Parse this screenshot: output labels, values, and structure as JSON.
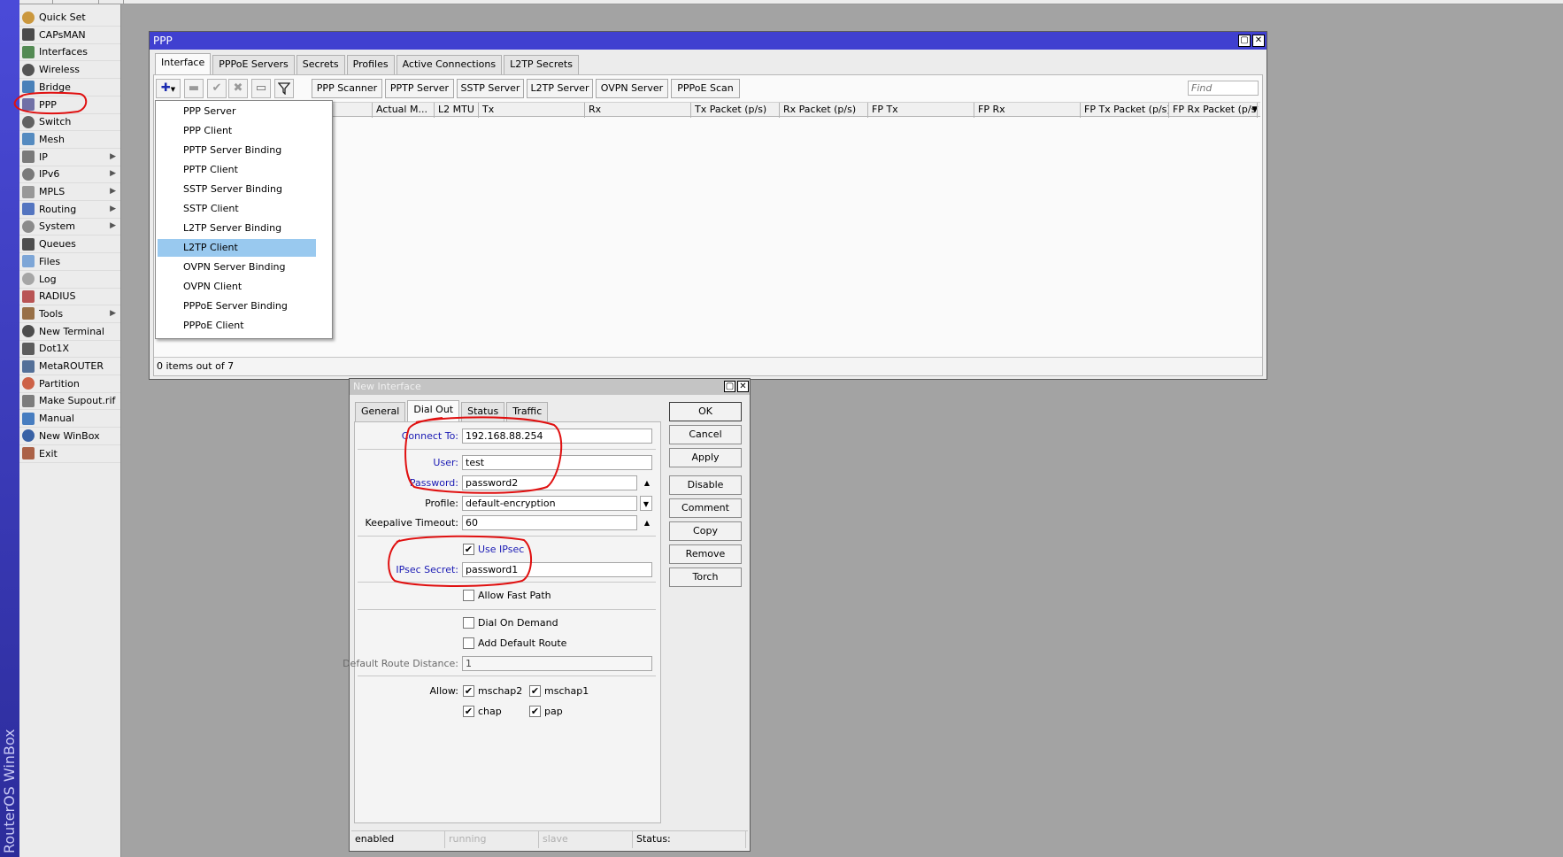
{
  "brand": "RouterOS WinBox",
  "sidebar": {
    "items": [
      {
        "label": "Quick Set",
        "icon": "quick-set-icon"
      },
      {
        "label": "CAPsMAN",
        "icon": "capsman-icon"
      },
      {
        "label": "Interfaces",
        "icon": "interfaces-icon"
      },
      {
        "label": "Wireless",
        "icon": "wireless-icon"
      },
      {
        "label": "Bridge",
        "icon": "bridge-icon"
      },
      {
        "label": "PPP",
        "icon": "ppp-icon"
      },
      {
        "label": "Switch",
        "icon": "switch-icon"
      },
      {
        "label": "Mesh",
        "icon": "mesh-icon"
      },
      {
        "label": "IP",
        "icon": "ip-icon",
        "submenu": true
      },
      {
        "label": "IPv6",
        "icon": "ipv6-icon",
        "submenu": true
      },
      {
        "label": "MPLS",
        "icon": "mpls-icon",
        "submenu": true
      },
      {
        "label": "Routing",
        "icon": "routing-icon",
        "submenu": true
      },
      {
        "label": "System",
        "icon": "system-icon",
        "submenu": true
      },
      {
        "label": "Queues",
        "icon": "queues-icon"
      },
      {
        "label": "Files",
        "icon": "files-icon"
      },
      {
        "label": "Log",
        "icon": "log-icon"
      },
      {
        "label": "RADIUS",
        "icon": "radius-icon"
      },
      {
        "label": "Tools",
        "icon": "tools-icon",
        "submenu": true
      },
      {
        "label": "New Terminal",
        "icon": "terminal-icon"
      },
      {
        "label": "Dot1X",
        "icon": "dot1x-icon"
      },
      {
        "label": "MetaROUTER",
        "icon": "metarouter-icon"
      },
      {
        "label": "Partition",
        "icon": "partition-icon"
      },
      {
        "label": "Make Supout.rif",
        "icon": "supout-icon"
      },
      {
        "label": "Manual",
        "icon": "manual-icon"
      },
      {
        "label": "New WinBox",
        "icon": "winbox-icon"
      },
      {
        "label": "Exit",
        "icon": "exit-icon"
      }
    ]
  },
  "ppp_window": {
    "title": "PPP",
    "tabs": [
      "Interface",
      "PPPoE Servers",
      "Secrets",
      "Profiles",
      "Active Connections",
      "L2TP Secrets"
    ],
    "active_tab": "Interface",
    "toolbar": {
      "buttons": [
        "PPP Scanner",
        "PPTP Server",
        "SSTP Server",
        "L2TP Server",
        "OVPN Server",
        "PPPoE Scan"
      ],
      "find_placeholder": "Find"
    },
    "columns": [
      "Actual M...",
      "L2 MTU",
      "Tx",
      "Rx",
      "Tx Packet (p/s)",
      "Rx Packet (p/s)",
      "FP Tx",
      "FP Rx",
      "FP Tx Packet (p/s)",
      "FP Rx Packet (p/s)"
    ],
    "status": "0 items out of 7",
    "add_menu": {
      "items": [
        "PPP Server",
        "PPP Client",
        "PPTP Server Binding",
        "PPTP Client",
        "SSTP Server Binding",
        "SSTP Client",
        "L2TP Server Binding",
        "L2TP Client",
        "OVPN Server Binding",
        "OVPN Client",
        "PPPoE Server Binding",
        "PPPoE Client"
      ],
      "selected": "L2TP Client"
    }
  },
  "new_interface": {
    "title": "New Interface",
    "tabs": [
      "General",
      "Dial Out",
      "Status",
      "Traffic"
    ],
    "active_tab": "Dial Out",
    "fields": {
      "connect_to": {
        "label": "Connect To:",
        "value": "192.168.88.254"
      },
      "user": {
        "label": "User:",
        "value": "test"
      },
      "password": {
        "label": "Password:",
        "value": "password2"
      },
      "profile": {
        "label": "Profile:",
        "value": "default-encryption"
      },
      "keepalive": {
        "label": "Keepalive Timeout:",
        "value": "60"
      },
      "use_ipsec": {
        "label": "Use IPsec",
        "checked": true
      },
      "ipsec_secret": {
        "label": "IPsec Secret:",
        "value": "password1"
      },
      "allow_fast_path": {
        "label": "Allow Fast Path",
        "checked": false
      },
      "dial_on_demand": {
        "label": "Dial On Demand",
        "checked": false
      },
      "add_default_route": {
        "label": "Add Default Route",
        "checked": false
      },
      "default_route_distance": {
        "label": "Default Route Distance:",
        "value": "1"
      },
      "allow": {
        "label": "Allow:",
        "options": [
          {
            "label": "mschap2",
            "checked": true
          },
          {
            "label": "mschap1",
            "checked": true
          },
          {
            "label": "chap",
            "checked": true
          },
          {
            "label": "pap",
            "checked": true
          }
        ]
      }
    },
    "buttons": [
      "OK",
      "Cancel",
      "Apply",
      "Disable",
      "Comment",
      "Copy",
      "Remove",
      "Torch"
    ],
    "statusbar": [
      "enabled",
      "running",
      "slave",
      "Status:"
    ]
  },
  "colors": {
    "titlebar": "#4040d0",
    "menu_selection": "#99c9ef",
    "field_label_blue": "#1a1ab4",
    "annotation_red": "#e01010"
  }
}
